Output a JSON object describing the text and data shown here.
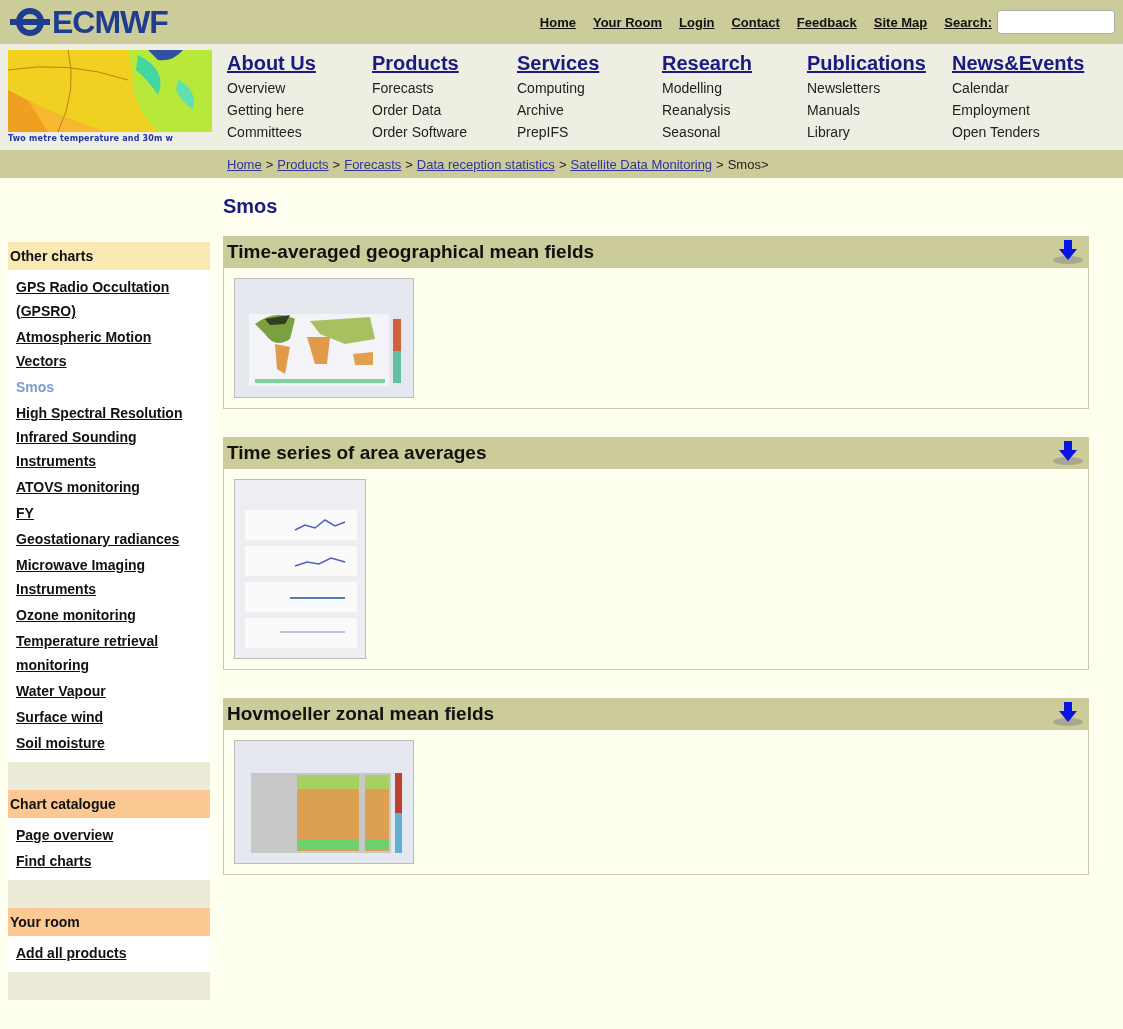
{
  "header": {
    "logo": "ECMWF",
    "top_links": [
      "Home",
      "Your Room",
      "Login",
      "Contact",
      "Feedback",
      "Site Map"
    ],
    "search": {
      "label": "Search:"
    }
  },
  "banner": {
    "caption": "Two metre temperature and 30m w"
  },
  "nav": [
    {
      "title": "About Us",
      "links": [
        "Overview",
        "Getting here",
        "Committees"
      ]
    },
    {
      "title": "Products",
      "links": [
        "Forecasts",
        "Order Data",
        "Order Software"
      ]
    },
    {
      "title": "Services",
      "links": [
        "Computing",
        "Archive",
        "PrepIFS"
      ]
    },
    {
      "title": "Research",
      "links": [
        "Modelling",
        "Reanalysis",
        "Seasonal"
      ]
    },
    {
      "title": "Publications",
      "links": [
        "Newsletters",
        "Manuals",
        "Library"
      ]
    },
    {
      "title": "News&Events",
      "links": [
        "Calendar",
        "Employment",
        "Open Tenders"
      ]
    }
  ],
  "breadcrumb": {
    "links": [
      "Home",
      "Products",
      "Forecasts",
      "Data reception statistics",
      "Satellite Data Monitoring"
    ],
    "separator": ">",
    "current": "Smos>"
  },
  "sidebar": [
    {
      "title": "Other charts",
      "color": "#fbe9b4",
      "items": [
        {
          "label": "GPS Radio Occultation (GPSRO)",
          "selected": false
        },
        {
          "label": "Atmospheric Motion Vectors",
          "selected": false
        },
        {
          "label": "Smos",
          "selected": true
        },
        {
          "label": "High Spectral Resolution Infrared Sounding Instruments",
          "selected": false
        },
        {
          "label": "ATOVS monitoring",
          "selected": false
        },
        {
          "label": "FY",
          "selected": false
        },
        {
          "label": "Geostationary radiances",
          "selected": false
        },
        {
          "label": "Microwave Imaging Instruments",
          "selected": false
        },
        {
          "label": "Ozone monitoring",
          "selected": false
        },
        {
          "label": "Temperature retrieval monitoring",
          "selected": false
        },
        {
          "label": "Water Vapour",
          "selected": false
        },
        {
          "label": "Surface wind",
          "selected": false
        },
        {
          "label": "Soil moisture",
          "selected": false
        }
      ]
    },
    {
      "title": "Chart catalogue",
      "color": "#fbc893",
      "items": [
        {
          "label": "Page overview",
          "selected": false
        },
        {
          "label": "Find charts",
          "selected": false
        }
      ]
    },
    {
      "title": "Your room",
      "color": "#fbc893",
      "items": [
        {
          "label": "Add all products",
          "selected": false
        }
      ]
    }
  ],
  "page_title": "Smos",
  "sections": [
    {
      "title": "Time-averaged geographical mean fields",
      "thumbnail": {
        "kind": "map"
      }
    },
    {
      "title": "Time series of area averages",
      "thumbnail": {
        "kind": "series"
      }
    },
    {
      "title": "Hovmoeller zonal mean fields",
      "thumbnail": {
        "kind": "hovmoeller"
      }
    }
  ]
}
